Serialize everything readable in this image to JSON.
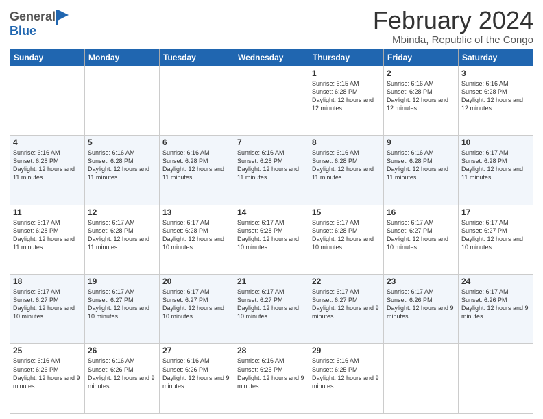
{
  "logo": {
    "general": "General",
    "blue": "Blue"
  },
  "header": {
    "title": "February 2024",
    "subtitle": "Mbinda, Republic of the Congo"
  },
  "days_of_week": [
    "Sunday",
    "Monday",
    "Tuesday",
    "Wednesday",
    "Thursday",
    "Friday",
    "Saturday"
  ],
  "weeks": [
    [
      {
        "day": "",
        "info": ""
      },
      {
        "day": "",
        "info": ""
      },
      {
        "day": "",
        "info": ""
      },
      {
        "day": "",
        "info": ""
      },
      {
        "day": "1",
        "info": "Sunrise: 6:15 AM\nSunset: 6:28 PM\nDaylight: 12 hours and 12 minutes."
      },
      {
        "day": "2",
        "info": "Sunrise: 6:16 AM\nSunset: 6:28 PM\nDaylight: 12 hours and 12 minutes."
      },
      {
        "day": "3",
        "info": "Sunrise: 6:16 AM\nSunset: 6:28 PM\nDaylight: 12 hours and 12 minutes."
      }
    ],
    [
      {
        "day": "4",
        "info": "Sunrise: 6:16 AM\nSunset: 6:28 PM\nDaylight: 12 hours and 11 minutes."
      },
      {
        "day": "5",
        "info": "Sunrise: 6:16 AM\nSunset: 6:28 PM\nDaylight: 12 hours and 11 minutes."
      },
      {
        "day": "6",
        "info": "Sunrise: 6:16 AM\nSunset: 6:28 PM\nDaylight: 12 hours and 11 minutes."
      },
      {
        "day": "7",
        "info": "Sunrise: 6:16 AM\nSunset: 6:28 PM\nDaylight: 12 hours and 11 minutes."
      },
      {
        "day": "8",
        "info": "Sunrise: 6:16 AM\nSunset: 6:28 PM\nDaylight: 12 hours and 11 minutes."
      },
      {
        "day": "9",
        "info": "Sunrise: 6:16 AM\nSunset: 6:28 PM\nDaylight: 12 hours and 11 minutes."
      },
      {
        "day": "10",
        "info": "Sunrise: 6:17 AM\nSunset: 6:28 PM\nDaylight: 12 hours and 11 minutes."
      }
    ],
    [
      {
        "day": "11",
        "info": "Sunrise: 6:17 AM\nSunset: 6:28 PM\nDaylight: 12 hours and 11 minutes."
      },
      {
        "day": "12",
        "info": "Sunrise: 6:17 AM\nSunset: 6:28 PM\nDaylight: 12 hours and 11 minutes."
      },
      {
        "day": "13",
        "info": "Sunrise: 6:17 AM\nSunset: 6:28 PM\nDaylight: 12 hours and 10 minutes."
      },
      {
        "day": "14",
        "info": "Sunrise: 6:17 AM\nSunset: 6:28 PM\nDaylight: 12 hours and 10 minutes."
      },
      {
        "day": "15",
        "info": "Sunrise: 6:17 AM\nSunset: 6:28 PM\nDaylight: 12 hours and 10 minutes."
      },
      {
        "day": "16",
        "info": "Sunrise: 6:17 AM\nSunset: 6:27 PM\nDaylight: 12 hours and 10 minutes."
      },
      {
        "day": "17",
        "info": "Sunrise: 6:17 AM\nSunset: 6:27 PM\nDaylight: 12 hours and 10 minutes."
      }
    ],
    [
      {
        "day": "18",
        "info": "Sunrise: 6:17 AM\nSunset: 6:27 PM\nDaylight: 12 hours and 10 minutes."
      },
      {
        "day": "19",
        "info": "Sunrise: 6:17 AM\nSunset: 6:27 PM\nDaylight: 12 hours and 10 minutes."
      },
      {
        "day": "20",
        "info": "Sunrise: 6:17 AM\nSunset: 6:27 PM\nDaylight: 12 hours and 10 minutes."
      },
      {
        "day": "21",
        "info": "Sunrise: 6:17 AM\nSunset: 6:27 PM\nDaylight: 12 hours and 10 minutes."
      },
      {
        "day": "22",
        "info": "Sunrise: 6:17 AM\nSunset: 6:27 PM\nDaylight: 12 hours and 9 minutes."
      },
      {
        "day": "23",
        "info": "Sunrise: 6:17 AM\nSunset: 6:26 PM\nDaylight: 12 hours and 9 minutes."
      },
      {
        "day": "24",
        "info": "Sunrise: 6:17 AM\nSunset: 6:26 PM\nDaylight: 12 hours and 9 minutes."
      }
    ],
    [
      {
        "day": "25",
        "info": "Sunrise: 6:16 AM\nSunset: 6:26 PM\nDaylight: 12 hours and 9 minutes."
      },
      {
        "day": "26",
        "info": "Sunrise: 6:16 AM\nSunset: 6:26 PM\nDaylight: 12 hours and 9 minutes."
      },
      {
        "day": "27",
        "info": "Sunrise: 6:16 AM\nSunset: 6:26 PM\nDaylight: 12 hours and 9 minutes."
      },
      {
        "day": "28",
        "info": "Sunrise: 6:16 AM\nSunset: 6:25 PM\nDaylight: 12 hours and 9 minutes."
      },
      {
        "day": "29",
        "info": "Sunrise: 6:16 AM\nSunset: 6:25 PM\nDaylight: 12 hours and 9 minutes."
      },
      {
        "day": "",
        "info": ""
      },
      {
        "day": "",
        "info": ""
      }
    ]
  ]
}
